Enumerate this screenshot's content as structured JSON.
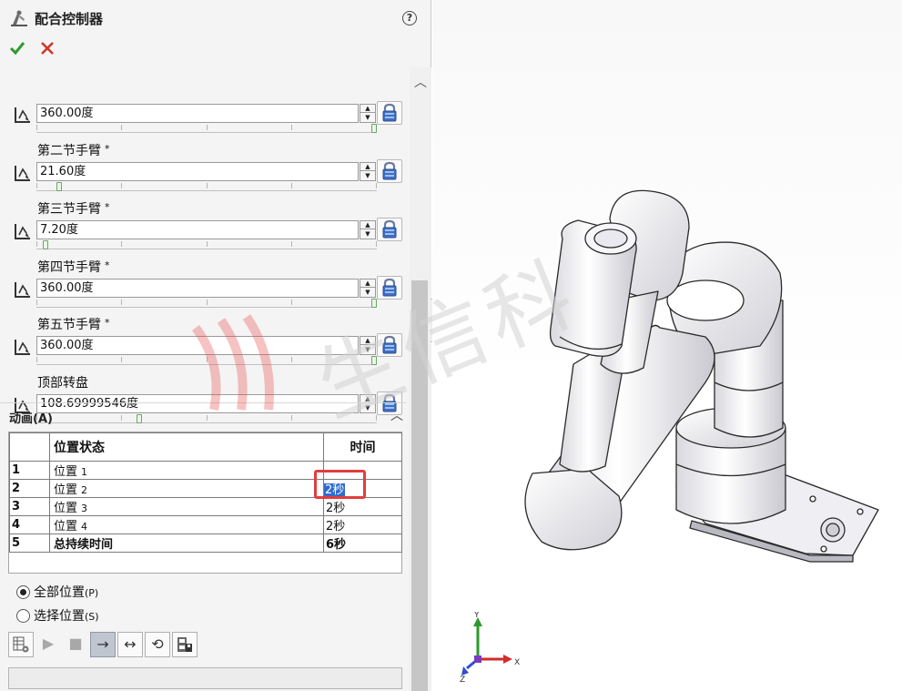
{
  "panel": {
    "title": "配合控制器",
    "help": "?",
    "ok_symbol": "✔",
    "cancel_symbol": "✕"
  },
  "mates": [
    {
      "label": "",
      "value": "360.00度",
      "slider_fraction": 1.0
    },
    {
      "label": "第二节手臂",
      "value": "21.60度",
      "slider_fraction": 0.06
    },
    {
      "label": "第三节手臂",
      "value": "7.20度",
      "slider_fraction": 0.02
    },
    {
      "label": "第四节手臂",
      "value": "360.00度",
      "slider_fraction": 1.0
    },
    {
      "label": "第五节手臂",
      "value": "360.00度",
      "slider_fraction": 1.0
    },
    {
      "label": "顶部转盘",
      "value": "108.69999546度",
      "slider_fraction": 0.3
    }
  ],
  "required_marker": "*",
  "animation": {
    "title": "动画(A)",
    "table": {
      "col_state": "位置状态",
      "col_time": "时间",
      "rows": [
        {
          "num": "1",
          "state": "位置",
          "state_num": "1",
          "time": ""
        },
        {
          "num": "2",
          "state": "位置",
          "state_num": "2",
          "time": "2秒"
        },
        {
          "num": "3",
          "state": "位置",
          "state_num": "3",
          "time": "2秒"
        },
        {
          "num": "4",
          "state": "位置",
          "state_num": "4",
          "time": "2秒"
        },
        {
          "num": "5",
          "state": "总持续时间",
          "state_num": "",
          "time": "6秒"
        }
      ]
    },
    "radio_all": {
      "label": "全部位置",
      "accel": "(P)",
      "checked": true
    },
    "radio_select": {
      "label": "选择位置",
      "accel": "(S)",
      "checked": false
    }
  },
  "toolbar": {
    "play": "▶",
    "stop": "■",
    "loop_once": "→",
    "reciprocate": "↔",
    "loop": "⟲"
  },
  "triad": {
    "x": "X",
    "y": "Y",
    "z": "Z"
  },
  "watermark": "生信科"
}
